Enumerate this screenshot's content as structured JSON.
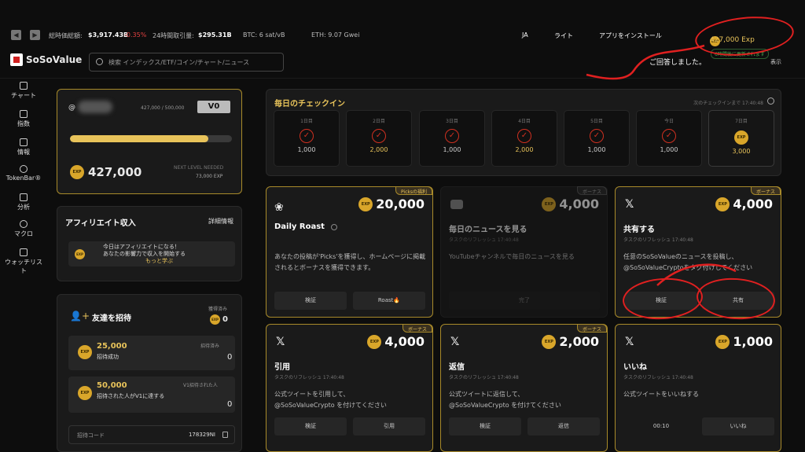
{
  "topbar": {
    "market_cap_label": "総時価総額:",
    "market_cap_value": "$3,917.43B",
    "market_cap_change": "-0.35%",
    "volume_label": "24時間取引量:",
    "volume_value": "$295.31B",
    "btc": "BTC: 6 sat/vB",
    "eth": "ETH: 9.07 Gwei",
    "lang": "JA",
    "theme": "ライト",
    "install": "アプリをインストール",
    "exp": "427,000 Exp"
  },
  "header": {
    "logo": "SoSoValue",
    "search_placeholder": "検索 インデックス/ETF/コイン/チャート/ニュース",
    "notice": "ご回答しました。",
    "notice_badge": "6時間後に更新されます",
    "display": "表示"
  },
  "sidebar": [
    {
      "label": "チャート"
    },
    {
      "label": "指数"
    },
    {
      "label": "情報"
    },
    {
      "label": "TokenBar®"
    },
    {
      "label": "分析"
    },
    {
      "label": "マクロ"
    },
    {
      "label": "ウォッチリスト"
    }
  ],
  "profile": {
    "handle": "@",
    "progress_text": "427,000 / 500,000",
    "progress": 0.854,
    "level": "V0",
    "exp": "427,000",
    "next_label": "NEXT LEVEL NEEDED",
    "next_value": "73,000 EXP"
  },
  "affiliate": {
    "title": "アフィリエイト収入",
    "details": "詳細情報",
    "text1": "今日はアフィリエイトになる！",
    "text2": "あなたの影響力で収入を開始する",
    "link": "もっと学ぶ"
  },
  "invite": {
    "title": "友達を招待",
    "earned_label": "獲得済み",
    "earned_value": "0",
    "r1_amount": "25,000",
    "r1_label": "招待成功",
    "r1_count_label": "招待済み",
    "r1_count": "0",
    "r2_amount": "50,000",
    "r2_label": "招待された人がV1に達する",
    "r2_count_label": "V1招待された人",
    "r2_count": "0",
    "code_label": "招待コード",
    "code_value": "178329NI"
  },
  "checkin": {
    "title": "毎日のチェックイン",
    "next": "次のチェックインまで 17:40:48",
    "days": [
      {
        "label": "1日目",
        "value": "1,000"
      },
      {
        "label": "2日目",
        "value": "2,000"
      },
      {
        "label": "3日目",
        "value": "1,000"
      },
      {
        "label": "4日目",
        "value": "2,000"
      },
      {
        "label": "5日目",
        "value": "1,000"
      },
      {
        "label": "今日",
        "value": "1,000"
      },
      {
        "label": "7日目",
        "value": "3,000"
      }
    ]
  },
  "tasks": [
    {
      "badge": "Picksの福利",
      "reward": "20,000",
      "title": "Daily Roast",
      "sub": "",
      "desc": "あなたの投稿が'Picks'を獲得し、ホームページに掲載されるとボーナスを獲得できます。",
      "btn1": "検証",
      "btn2": "Roast🔥"
    },
    {
      "badge": "ボーナス",
      "reward": "4,000",
      "title": "毎日のニュースを見る",
      "sub": "タスクのリフレッシュ 17:40:48",
      "desc": "YouTubeチャンネルで毎日のニュースを見る",
      "btn1": "完了",
      "btn2": ""
    },
    {
      "badge": "ボーナス",
      "reward": "4,000",
      "title": "共有する",
      "sub": "タスクのリフレッシュ 17:40:48",
      "desc": "任意のSoSoValueのニュースを投稿し、@SoSoValueCryptoをタグ付けしてください",
      "btn1": "検証",
      "btn2": "共有"
    },
    {
      "badge": "ボーナス",
      "reward": "4,000",
      "title": "引用",
      "sub": "タスクのリフレッシュ 17:40:48",
      "desc": "公式ツイートを引用して、@SoSoValueCrypto を付けてください",
      "btn1": "検証",
      "btn2": "引用"
    },
    {
      "badge": "ボーナス",
      "reward": "2,000",
      "title": "返信",
      "sub": "タスクのリフレッシュ 17:40:48",
      "desc": "公式ツイートに返信して、@SoSoValueCrypto を付けてください",
      "btn1": "検証",
      "btn2": "返信"
    },
    {
      "badge": "ボーナス",
      "reward": "1,000",
      "title": "いいね",
      "sub": "タスクのリフレッシュ 17:40:48",
      "desc": "公式ツイートをいいねする",
      "btn1": "00:10",
      "btn2": "いいね"
    }
  ]
}
